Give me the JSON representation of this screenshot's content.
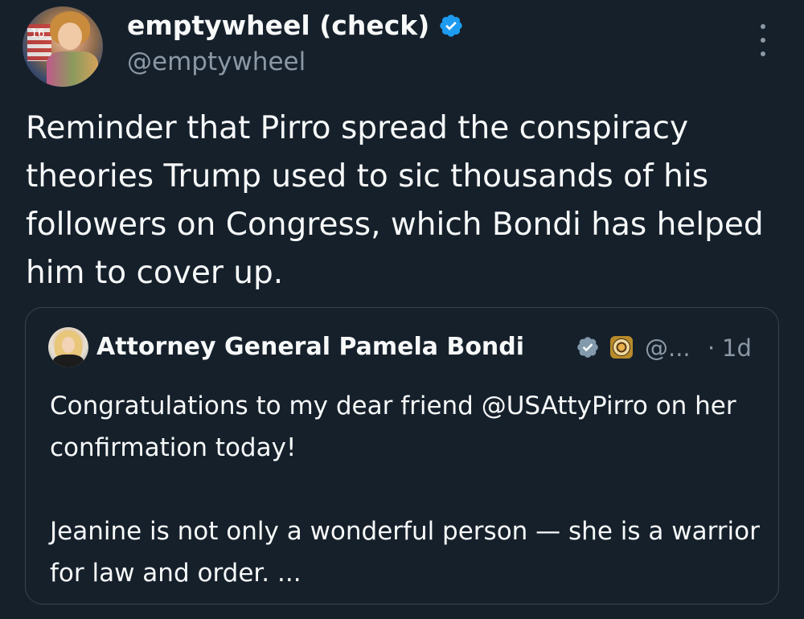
{
  "author": {
    "display_name": "emptywheel (check)",
    "handle": "@emptywheel",
    "avatar_label": "16",
    "verified_icon": "verified-badge-icon",
    "accent": "#1d9bf0"
  },
  "menu": {
    "icon": "more-options-icon"
  },
  "tweet": {
    "text": "Reminder that Pirro spread the conspiracy theories Trump used to sic thousands of his followers on Congress, which Bondi has helped him to cover up."
  },
  "quoted": {
    "display_name": "Attorney General Pamela Bondi",
    "handle": "@...",
    "separator": "·",
    "time": "1d",
    "verified_icon": "gray-verified-badge-icon",
    "affiliate_icon": "doj-seal-icon",
    "para1": "Congratulations to my dear friend @USAttyPirro on her confirmation today!",
    "para2": "Jeanine is not only a wonderful person — she is a warrior for law and order. ..."
  },
  "colors": {
    "background": "#15202b",
    "text": "#f7f9f9",
    "secondary": "#8b98a5",
    "border": "#38444d"
  }
}
